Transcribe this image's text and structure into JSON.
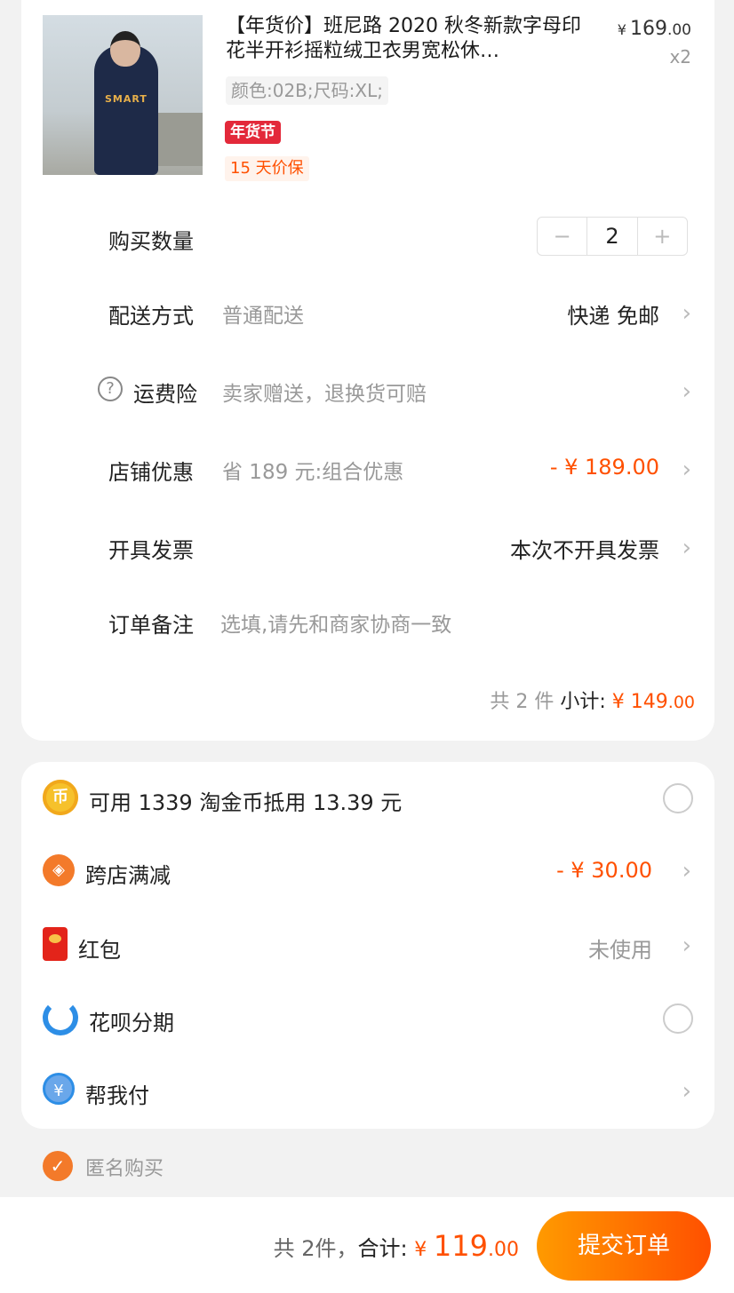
{
  "product": {
    "title": "【年货价】班尼路 2020 秋冬新款字母印花半开衫摇粒绒卫衣男宽松休…",
    "price_currency": "¥",
    "price_int": "169",
    "price_dec": ".00",
    "quantity": "x2",
    "sku": "颜色:02B;尺码:XL;",
    "badge": "年货节",
    "tag": "15 天价保",
    "image_text": "SMART"
  },
  "quantity_row": {
    "label": "购买数量",
    "value": "2",
    "minus": "−",
    "plus": "+"
  },
  "delivery": {
    "label": "配送方式",
    "sub": "普通配送",
    "value": "快递 免邮"
  },
  "insurance": {
    "icon": "?",
    "label": "运费险",
    "sub": "卖家赠送，退换货可赔"
  },
  "store_discount": {
    "label": "店铺优惠",
    "sub": "省 189 元:组合优惠",
    "value": "- ¥ 189.00"
  },
  "invoice": {
    "label": "开具发票",
    "value": "本次不开具发票"
  },
  "note": {
    "label": "订单备注",
    "placeholder": "选填,请先和商家协商一致"
  },
  "subtotal": {
    "count": "共 2 件",
    "label": "小计:",
    "currency": "¥",
    "amount_int": "149",
    "amount_dec": ".00"
  },
  "payments": {
    "coins": {
      "icon": "币",
      "label": "可用 1339 淘金币抵用 13.39 元"
    },
    "cross_store": {
      "icon": "◈",
      "label": "跨店满减",
      "value": "- ¥ 30.00"
    },
    "red_packet": {
      "label": "红包",
      "value": "未使用"
    },
    "huabei": {
      "label": "花呗分期"
    },
    "help_pay": {
      "icon": "¥",
      "label": "帮我付"
    }
  },
  "anonymous": {
    "label": "匿名购买",
    "check": "✓"
  },
  "footer": {
    "count": "共 2件，",
    "total_label": "合计:",
    "currency": "¥",
    "amount_int": "119",
    "amount_dec": ".00",
    "submit": "提交订单"
  },
  "chevron": "›",
  "colors": {
    "accent": "#ff5000",
    "badge": "#e3293a"
  }
}
